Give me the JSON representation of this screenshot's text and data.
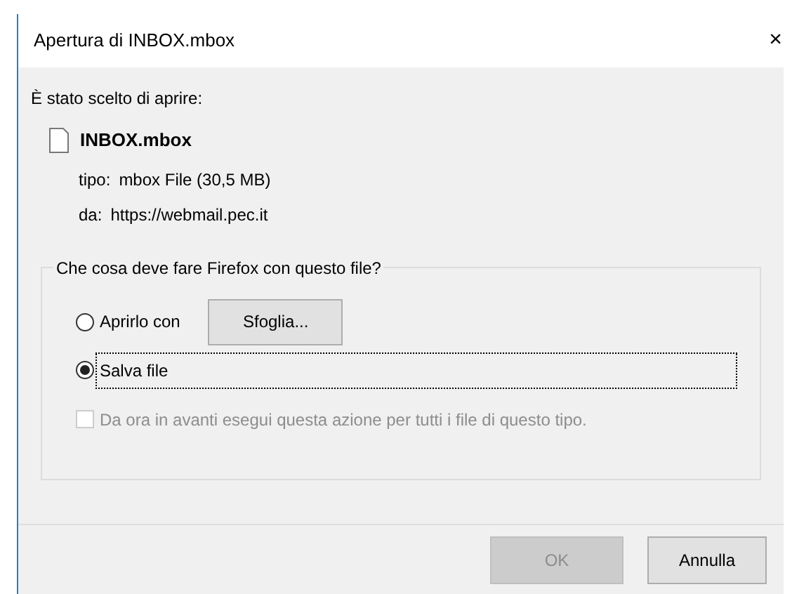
{
  "window": {
    "title": "Apertura di INBOX.mbox",
    "close": "×"
  },
  "intro": "È stato scelto di aprire:",
  "file": {
    "name": "INBOX.mbox",
    "type_label": "tipo:",
    "type": "mbox File (30,5 MB)",
    "from_label": "da:",
    "from": "https://webmail.pec.it"
  },
  "group": {
    "title": "Che cosa deve fare Firefox con questo file?",
    "options": [
      {
        "label": "Aprirlo con",
        "selected": false,
        "focused": false,
        "button": "Sfoglia..."
      },
      {
        "label": "Salva file",
        "selected": true,
        "focused": true
      }
    ],
    "remember": {
      "label": "Da ora in avanti esegui questa azione per tutti i file di questo tipo.",
      "checked": false,
      "disabled": true
    }
  },
  "buttons": [
    {
      "label": "OK",
      "disabled": true
    },
    {
      "label": "Annulla",
      "disabled": false
    }
  ]
}
